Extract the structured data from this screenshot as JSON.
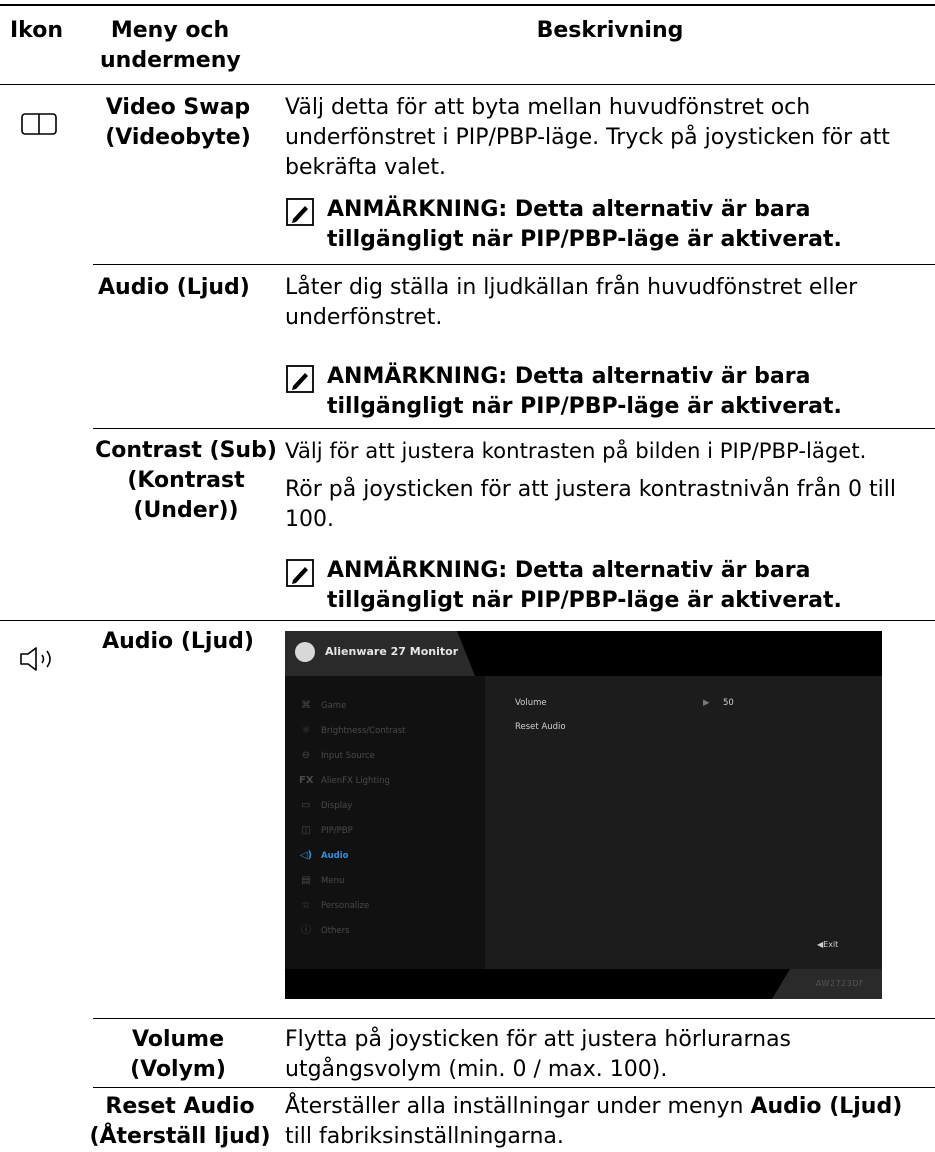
{
  "headers": {
    "icon": "Ikon",
    "menu": "Meny och undermeny",
    "description": "Beskrivning"
  },
  "rows": {
    "video_swap": {
      "menu": "Video Swap (Videobyte)",
      "desc": "Välj detta för att byta mellan huvudfönstret och underfönstret i PIP/PBP-läge. Tryck på joysticken för att bekräfta valet.",
      "note": "ANMÄRKNING: Detta alternativ är bara tillgängligt när PIP/PBP-läge är aktiverat."
    },
    "audio_sub": {
      "menu": "Audio (Ljud)",
      "desc": "Låter dig ställa in ljudkällan från huvudfönstret eller underfönstret.",
      "note": "ANMÄRKNING: Detta alternativ är bara tillgängligt när PIP/PBP-läge är aktiverat."
    },
    "contrast_sub": {
      "menu": "Contrast (Sub) (Kontrast (Under))",
      "desc1": "Välj för att justera kontrasten på bilden i PIP/PBP-läget.",
      "desc2": "Rör på joysticken för att justera kontrastnivån från 0 till 100.",
      "note": "ANMÄRKNING: Detta alternativ är bara tillgängligt när PIP/PBP-läge är aktiverat."
    },
    "audio": {
      "menu": "Audio (Ljud)"
    },
    "volume": {
      "menu": "Volume (Volym)",
      "desc": "Flytta på joysticken för att justera hörlurarnas utgångsvolym (min. 0 / max. 100)."
    },
    "reset_audio": {
      "menu": "Reset Audio (Återställ ljud)",
      "desc_prefix": "Återställer alla inställningar under menyn ",
      "desc_bold": "Audio (Ljud)",
      "desc_suffix": " till fabriksinställningarna."
    }
  },
  "osd": {
    "title": "Alienware 27 Monitor",
    "menu_items": [
      {
        "label": "Game",
        "icon": "gamepad-icon"
      },
      {
        "label": "Brightness/Contrast",
        "icon": "sun-icon"
      },
      {
        "label": "Input Source",
        "icon": "input-icon"
      },
      {
        "label": "AlienFX Lighting",
        "icon": "fx-icon"
      },
      {
        "label": "Display",
        "icon": "monitor-icon"
      },
      {
        "label": "PIP/PBP",
        "icon": "pip-icon"
      },
      {
        "label": "Audio",
        "icon": "speaker-icon"
      },
      {
        "label": "Menu",
        "icon": "menu-icon"
      },
      {
        "label": "Personalize",
        "icon": "star-icon"
      },
      {
        "label": "Others",
        "icon": "info-icon"
      }
    ],
    "active_item": "Audio",
    "volume_label": "Volume",
    "volume_value": "50",
    "reset_label": "Reset Audio",
    "exit_label": "Exit",
    "model": "AW2723DF",
    "accent_color": "#2f8fe0"
  }
}
